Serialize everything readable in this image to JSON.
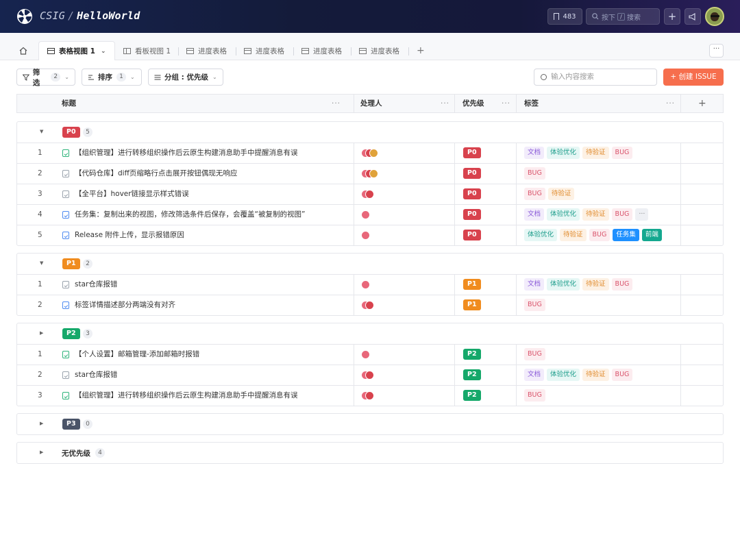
{
  "header": {
    "org": "CSIG",
    "sep": "/",
    "repo": "HelloWorld",
    "star_count": "483",
    "search_prefix": "按下",
    "search_key": "/",
    "search_suffix": "搜索",
    "plus": "+"
  },
  "tabs": {
    "active": "表格视图 1",
    "items": [
      "看板视图 1",
      "进度表格",
      "进度表格",
      "进度表格",
      "进度表格"
    ],
    "add": "+",
    "more": "···"
  },
  "toolbar": {
    "filter_label": "筛选",
    "filter_count": "2",
    "sort_label": "排序",
    "sort_count": "1",
    "group_label": "分组 : 优先级",
    "search_placeholder": "输入内容搜索",
    "create_label": "+ 创建 ISSUE"
  },
  "columns": {
    "title": "标题",
    "assignee": "处理人",
    "priority": "优先级",
    "tags": "标签",
    "dots": "···",
    "add": "+"
  },
  "colors": {
    "P0": "#d8424d",
    "P1": "#f08c1f",
    "P2": "#15a86a",
    "P3": "#4a5468",
    "accent": "#f66e4d"
  },
  "groups": [
    {
      "label": "P0",
      "count": "5",
      "caret": "▼",
      "rows": [
        {
          "num": "1",
          "icon": "green",
          "title": "【组织管理】进行转移组织操作后云原生构建消息助手中提醒消息有误",
          "avatars": 3,
          "tags": [
            [
              "文档",
              "doc"
            ],
            [
              "体验优化",
              "ux"
            ],
            [
              "待验证",
              "verify"
            ],
            [
              "BUG",
              "bug"
            ]
          ]
        },
        {
          "num": "2",
          "icon": "grey",
          "title": "【代码仓库】diff页缩略行点击展开按钮偶现无响应",
          "avatars": 3,
          "tags": [
            [
              "BUG",
              "bug"
            ]
          ]
        },
        {
          "num": "3",
          "icon": "grey",
          "title": "【全平台】hover链接显示样式错误",
          "avatars": 2,
          "tags": [
            [
              "BUG",
              "bug"
            ],
            [
              "待验证",
              "verify"
            ]
          ]
        },
        {
          "num": "4",
          "icon": "blue",
          "title": "任务集：复制出来的视图，修改筛选条件后保存，会覆盖“被复制的视图”",
          "avatars": 1,
          "tags": [
            [
              "文档",
              "doc"
            ],
            [
              "体验优化",
              "ux"
            ],
            [
              "待验证",
              "verify"
            ],
            [
              "BUG",
              "bug"
            ],
            [
              "···",
              "more"
            ]
          ]
        },
        {
          "num": "5",
          "icon": "blue",
          "title": "Release 附件上传，显示报错原因",
          "avatars": 1,
          "tags": [
            [
              "体验优化",
              "ux"
            ],
            [
              "待验证",
              "verify"
            ],
            [
              "BUG",
              "bug"
            ],
            [
              "任务集",
              "task"
            ],
            [
              "前端",
              "fe"
            ]
          ]
        }
      ]
    },
    {
      "label": "P1",
      "count": "2",
      "caret": "▼",
      "rows": [
        {
          "num": "1",
          "icon": "grey",
          "title": "star仓库报错",
          "avatars": 1,
          "tags": [
            [
              "文档",
              "doc"
            ],
            [
              "体验优化",
              "ux"
            ],
            [
              "待验证",
              "verify"
            ],
            [
              "BUG",
              "bug"
            ]
          ]
        },
        {
          "num": "2",
          "icon": "blue",
          "title": "标签详情描述部分两端没有对齐",
          "avatars": 2,
          "tags": [
            [
              "BUG",
              "bug"
            ]
          ]
        }
      ]
    },
    {
      "label": "P2",
      "count": "3",
      "caret": "▶",
      "rows": [
        {
          "num": "1",
          "icon": "green",
          "title": "【个人设置】邮箱管理-添加邮箱时报错",
          "avatars": 1,
          "tags": [
            [
              "BUG",
              "bug"
            ]
          ]
        },
        {
          "num": "2",
          "icon": "grey",
          "title": "star仓库报错",
          "avatars": 2,
          "tags": [
            [
              "文档",
              "doc"
            ],
            [
              "体验优化",
              "ux"
            ],
            [
              "待验证",
              "verify"
            ],
            [
              "BUG",
              "bug"
            ]
          ]
        },
        {
          "num": "3",
          "icon": "green",
          "title": "【组织管理】进行转移组织操作后云原生构建消息助手中提醒消息有误",
          "avatars": 2,
          "tags": [
            [
              "BUG",
              "bug"
            ]
          ]
        }
      ]
    },
    {
      "label": "P3",
      "count": "0",
      "caret": "▶",
      "rows": []
    },
    {
      "label": "无优先级",
      "count": "4",
      "caret": "▶",
      "rows": [],
      "plain": true
    }
  ]
}
